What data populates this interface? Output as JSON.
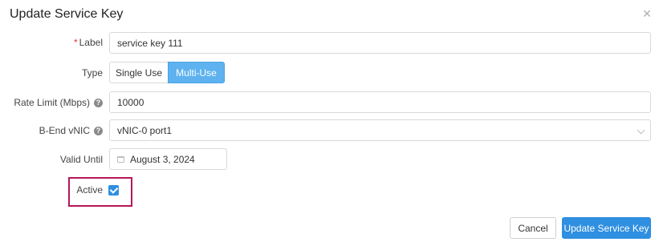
{
  "dialog": {
    "title": "Update Service Key",
    "close_icon": "close-icon"
  },
  "form": {
    "label": {
      "label": "Label",
      "required_marker": "*",
      "value": "service key 111"
    },
    "type": {
      "label": "Type",
      "options": [
        "Single Use",
        "Multi-Use"
      ],
      "selected": "Multi-Use"
    },
    "rate_limit": {
      "label": "Rate Limit (Mbps)",
      "help_icon": "question-circle-icon",
      "help_glyph": "?",
      "value": "10000"
    },
    "b_end_vnic": {
      "label": "B-End vNIC",
      "help_icon": "question-circle-icon",
      "help_glyph": "?",
      "value": "vNIC-0 port1",
      "dropdown_icon": "chevron-down-icon"
    },
    "valid_until": {
      "label": "Valid Until",
      "calendar_icon": "calendar-icon",
      "value": "August 3, 2024"
    },
    "active": {
      "label": "Active",
      "checked": true,
      "highlight_color": "#b5175a"
    }
  },
  "buttons": {
    "cancel": "Cancel",
    "submit": "Update Service Key"
  },
  "colors": {
    "primary": "#2f8fe0",
    "segment_selected": "#5db2ef",
    "required": "#e53935"
  }
}
